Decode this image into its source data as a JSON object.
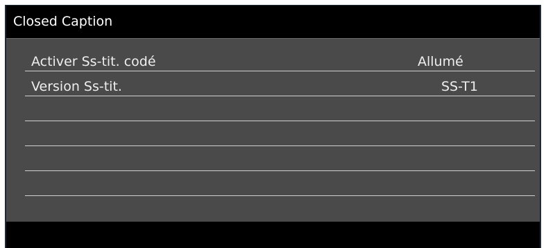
{
  "header": {
    "title": "Closed Caption"
  },
  "menu": {
    "rows": [
      {
        "label": "Activer Ss-tit. codé",
        "value": "Allumé"
      },
      {
        "label": "Version Ss-tit.",
        "value": "SS-T1"
      },
      {
        "label": "",
        "value": ""
      },
      {
        "label": "",
        "value": ""
      },
      {
        "label": "",
        "value": ""
      },
      {
        "label": "",
        "value": ""
      }
    ]
  },
  "colors": {
    "panel_background": "#4a4a4a",
    "header_background": "#000000",
    "footer_background": "#000000",
    "divider": "#d2d2d2",
    "text": "#ffffff"
  }
}
